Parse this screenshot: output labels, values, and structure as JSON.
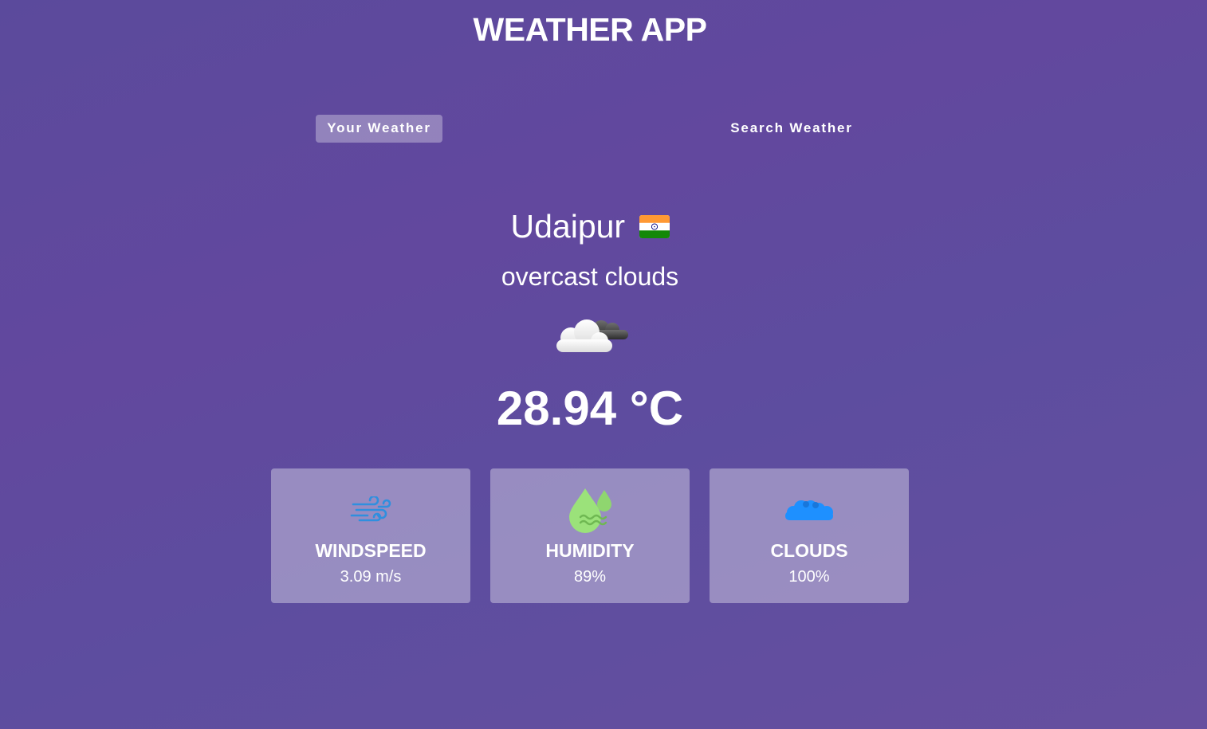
{
  "app": {
    "title": "WEATHER APP"
  },
  "tabs": [
    {
      "label": "Your Weather",
      "active": true
    },
    {
      "label": "Search Weather",
      "active": false
    }
  ],
  "weather": {
    "city": "Udaipur",
    "country_flag_icon": "india-flag-icon",
    "description": "overcast clouds",
    "condition_icon": "cloud-with-moon-icon",
    "temperature": "28.94 °C"
  },
  "stats": [
    {
      "label": "WINDSPEED",
      "value": "3.09 m/s",
      "icon": "wind-icon"
    },
    {
      "label": "HUMIDITY",
      "value": "89%",
      "icon": "humidity-droplets-icon"
    },
    {
      "label": "CLOUDS",
      "value": "100%",
      "icon": "clouds-icon"
    }
  ],
  "colors": {
    "background_start": "#5b4a9c",
    "background_end": "#664f9f",
    "card_background": "rgba(255,255,255,0.36)",
    "active_tab_background": "rgba(255,255,255,0.32)",
    "wind_icon": "#2f8fdf",
    "humidity_icon": "#9be27a",
    "clouds_icon": "#1e90ff"
  }
}
